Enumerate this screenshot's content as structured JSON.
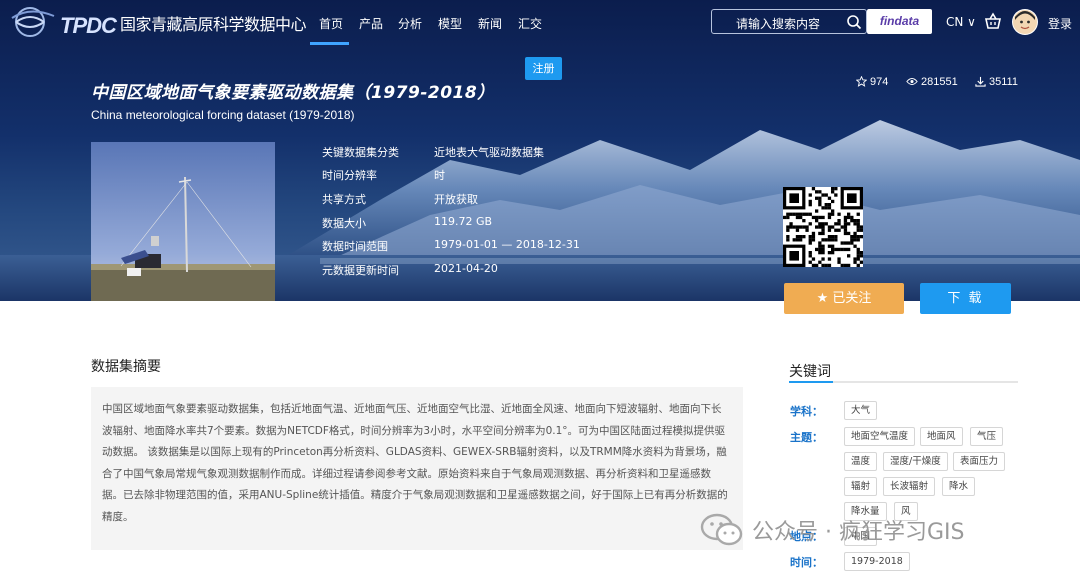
{
  "header": {
    "logo_text": "TPDC",
    "site_name": "国家青藏高原科学数据中心",
    "nav": [
      {
        "label": "首页",
        "active": true
      },
      {
        "label": "产品"
      },
      {
        "label": "分析"
      },
      {
        "label": "模型"
      },
      {
        "label": "新闻"
      },
      {
        "label": "汇交"
      }
    ],
    "search_placeholder": "请输入搜索内容",
    "findata_label": "findata",
    "language": "CN",
    "login_label": "登录"
  },
  "dataset": {
    "register_label": "注册",
    "title": "中国区域地面气象要素驱动数据集（1979-2018）",
    "subtitle": "China meteorological forcing dataset (1979-2018)",
    "stats": {
      "stars": "974",
      "views": "281551",
      "downloads": "35111"
    },
    "meta": [
      {
        "label": "关键数据集分类",
        "value": "近地表大气驱动数据集"
      },
      {
        "label": "时间分辨率",
        "value": "时"
      },
      {
        "label": "共享方式",
        "value": "开放获取"
      },
      {
        "label": "数据大小",
        "value": "119.72 GB"
      },
      {
        "label": "数据时间范围",
        "value": "1979-01-01 — 2018-12-31"
      },
      {
        "label": "元数据更新时间",
        "value": "2021-04-20"
      }
    ],
    "follow_label": "已关注",
    "download_label": "下 载"
  },
  "abstract": {
    "heading": "数据集摘要",
    "text": "中国区域地面气象要素驱动数据集，包括近地面气温、近地面气压、近地面空气比湿、近地面全风速、地面向下短波辐射、地面向下长波辐射、地面降水率共7个要素。数据为NETCDF格式，时间分辨率为3小时，水平空间分辨率为0.1°。可为中国区陆面过程模拟提供驱动数据。 该数据集是以国际上现有的Princeton再分析资料、GLDAS资料、GEWEX-SRB辐射资料，以及TRMM降水资料为背景场，融合了中国气象局常规气象观测数据制作而成。详细过程请参阅参考文献。原始资料来自于气象局观测数据、再分析资料和卫星遥感数据。已去除非物理范围的值，采用ANU-Spline统计插值。精度介于气象局观测数据和卫星遥感数据之间，好于国际上已有再分析数据的精度。"
  },
  "keywords": {
    "heading": "关键词",
    "subject_label": "学科：",
    "subject_tags": [
      "大气"
    ],
    "theme_label": "主题：",
    "theme_tags": [
      "地面空气温度",
      "地面风",
      "气压",
      "温度",
      "湿度/干燥度",
      "表面压力",
      "辐射",
      "长波辐射",
      "降水",
      "降水量",
      "风"
    ],
    "place_label": "地点：",
    "place_tags": [
      "中国"
    ],
    "time_label": "时间：",
    "time_tags": [
      "1979-2018"
    ]
  },
  "watermark": {
    "text": "公众号 · 疯狂学习GIS"
  }
}
